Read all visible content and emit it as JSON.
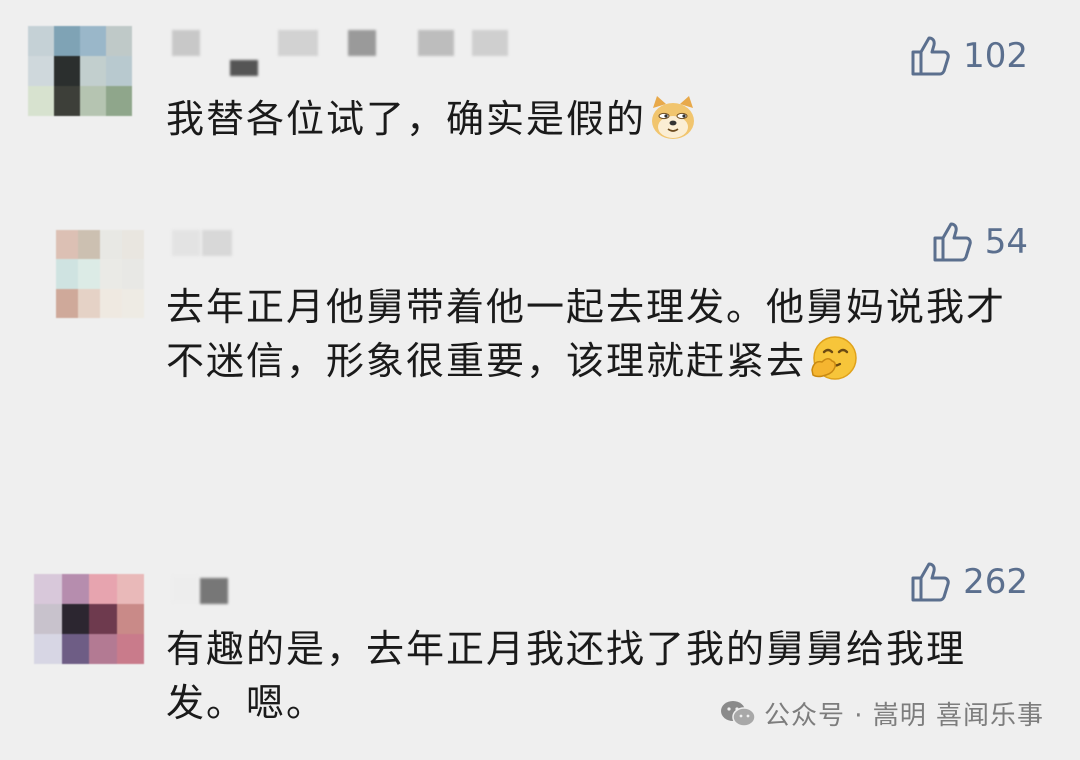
{
  "comments": [
    {
      "likes": "102",
      "text": "我替各位试了，确实是假的",
      "emoji": "doge-emoji",
      "avatar_colors": [
        "#c5d1d6",
        "#7fa3b5",
        "#9ab7c9",
        "#bfc9c8",
        "#cfd8dc",
        "#2b2f2e",
        "#c2cfce",
        "#b8c9cf",
        "#d7e2cf",
        "#3d3f39",
        "#b5c4b1",
        "#8fa68b"
      ]
    },
    {
      "likes": "54",
      "text": "去年正月他舅带着他一起去理发。他舅妈说我才不迷信，形象很重要，该理就赶紧去",
      "emoji": "hehe-emoji",
      "avatar_colors": [
        "#dcc0b4",
        "#ccc0b1",
        "#e8e8e4",
        "#e9e6e0",
        "#cfe3e1",
        "#dcebe6",
        "#eaeae6",
        "#e8e8e5",
        "#cfa99a",
        "#e5d2c6",
        "#efe9e1",
        "#eeebe4"
      ]
    },
    {
      "likes": "262",
      "text": "有趣的是，去年正月我还找了我的舅舅给我理发。嗯。",
      "emoji": "",
      "avatar_colors": [
        "#d8c8da",
        "#b68dae",
        "#e7a4af",
        "#e9b9b9",
        "#c8c2cc",
        "#2c2630",
        "#6e3a4e",
        "#c98a88",
        "#d7d6e4",
        "#6e5d85",
        "#b37a93",
        "#c97b8b"
      ]
    }
  ],
  "watermark": {
    "icon": "wechat-icon",
    "text": "公众号 · 嵩明 喜闻乐事"
  },
  "colors": {
    "background": "#efefef",
    "like_color": "#5b6f8e",
    "text_color": "#1a1a1a"
  }
}
